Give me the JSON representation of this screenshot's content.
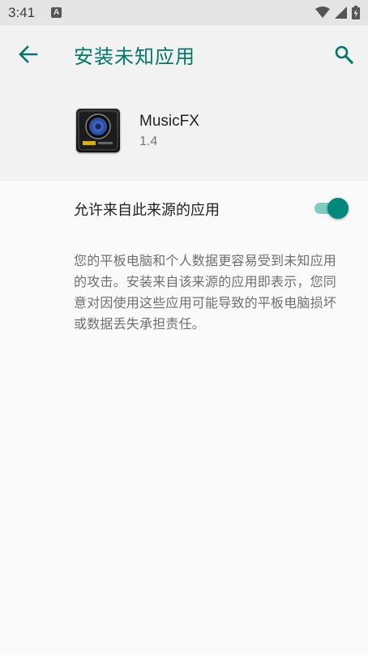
{
  "status_bar": {
    "time": "3:41",
    "notification_icon": "a-icon",
    "icons": [
      "wifi-icon",
      "cell-signal-icon",
      "battery-icon"
    ]
  },
  "app_bar": {
    "title": "安装未知应用",
    "back_icon": "arrow-left-icon",
    "search_icon": "search-icon",
    "accent_color": "#00796b"
  },
  "app_info": {
    "name": "MusicFX",
    "version": "1.4",
    "icon": "speaker-icon"
  },
  "setting": {
    "label": "允许来自此来源的应用",
    "enabled": true,
    "switch_color": "#00897b"
  },
  "description": "您的平板电脑和个人数据更容易受到未知应用的攻击。安装来自该来源的应用即表示，您同意对因使用这些应用可能导致的平板电脑损坏或数据丢失承担责任。"
}
